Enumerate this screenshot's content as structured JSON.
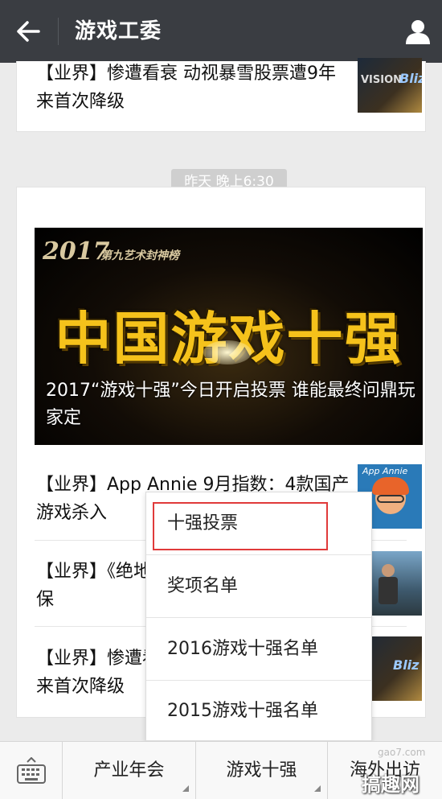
{
  "header": {
    "title": "游戏工委"
  },
  "top_card": {
    "title": "【业界】惨遭看衰 动视暴雪股票遭9年来首次降级",
    "thumb_text_left": "VISION",
    "thumb_text_right": "Bliz"
  },
  "timestamp": "昨天 晚上6:30",
  "main_card": {
    "banner": {
      "year": "2017",
      "subtitle": "第九艺术封神榜",
      "big_text": "中国游戏十强",
      "caption": "2017“游戏十强”今日开启投票 谁能最终问鼎玩家定"
    },
    "items": [
      {
        "title": "【业界】App Annie 9月指数：4款国产游戏杀入",
        "thumb_label": "App Annie"
      },
      {
        "title": "【业界】《绝地求生》火爆后他还在吃低保",
        "thumb_label": ""
      },
      {
        "title": "【业界】惨遭看衰 动视暴雪股票遭9年来首次降级",
        "thumb_label": "Bliz"
      }
    ]
  },
  "popup_menu": {
    "items": [
      "十强投票",
      "奖项名单",
      "2016游戏十强名单",
      "2015游戏十强名单"
    ]
  },
  "bottom_menu": {
    "tabs": [
      "产业年会",
      "游戏十强",
      "海外出访"
    ]
  },
  "watermark": {
    "text": "搞趣网",
    "url": "gao7.com"
  },
  "colors": {
    "topbar": "#3a3d42",
    "highlight": "#e03a3a",
    "banner_gold": "#f5c21b"
  }
}
